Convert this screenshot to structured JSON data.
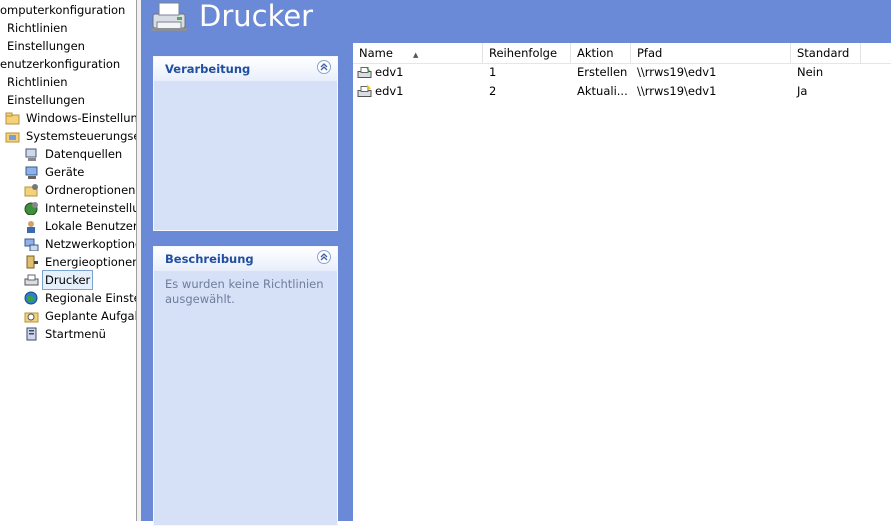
{
  "tree": {
    "items": [
      {
        "label": "omputerkonfiguration",
        "icon": "none",
        "x": 0
      },
      {
        "label": "Richtlinien",
        "icon": "none",
        "x": 7
      },
      {
        "label": "Einstellungen",
        "icon": "none",
        "x": 7
      },
      {
        "label": "enutzerkonfiguration",
        "icon": "none",
        "x": 0
      },
      {
        "label": "Richtlinien",
        "icon": "none",
        "x": 7
      },
      {
        "label": "Einstellungen",
        "icon": "none",
        "x": 7
      },
      {
        "label": "Windows-Einstellung",
        "icon": "folder-icon",
        "x": 5
      },
      {
        "label": "Systemsteuerungseir",
        "icon": "control-panel-icon",
        "x": 5
      },
      {
        "label": "Datenquellen",
        "icon": "datasource-icon",
        "x": 24
      },
      {
        "label": "Geräte",
        "icon": "devices-icon",
        "x": 24
      },
      {
        "label": "Ordneroptionen",
        "icon": "folder-options-icon",
        "x": 24
      },
      {
        "label": "Interneteinstellur",
        "icon": "internet-settings-icon",
        "x": 24
      },
      {
        "label": "Lokale Benutzer u",
        "icon": "local-users-icon",
        "x": 24
      },
      {
        "label": "Netzwerkoptione",
        "icon": "network-icon",
        "x": 24
      },
      {
        "label": "Energieoptionen",
        "icon": "power-icon",
        "x": 24
      },
      {
        "label": "Drucker",
        "icon": "printer-icon",
        "x": 24,
        "selected": true
      },
      {
        "label": "Regionale Einstel",
        "icon": "globe-icon",
        "x": 24
      },
      {
        "label": "Geplante Aufgab",
        "icon": "scheduled-task-icon",
        "x": 24
      },
      {
        "label": "Startmenü",
        "icon": "start-menu-icon",
        "x": 24
      }
    ]
  },
  "header": {
    "title": "Drucker",
    "icon": "printer-icon"
  },
  "panels": {
    "processing": {
      "title": "Verarbeitung",
      "body": ""
    },
    "description": {
      "title": "Beschreibung",
      "body": "Es wurden keine Richtlinien ausgewählt."
    }
  },
  "list": {
    "columns": [
      "Name",
      "Reihenfolge",
      "Aktion",
      "Pfad",
      "Standard"
    ],
    "sorted_column": "Name",
    "rows": [
      {
        "name": "edv1",
        "order": "1",
        "action": "Erstellen",
        "path": "\\\\rrws19\\edv1",
        "default": "Nein",
        "icon": "printer-create-icon"
      },
      {
        "name": "edv1",
        "order": "2",
        "action": "Aktuali...",
        "path": "\\\\rrws19\\edv1",
        "default": "Ja",
        "icon": "printer-update-icon"
      }
    ]
  },
  "colors": {
    "header_bg": "#6a8ad8",
    "panel_bg": "#d6e0f6",
    "panel_title": "#1f4fa0"
  }
}
